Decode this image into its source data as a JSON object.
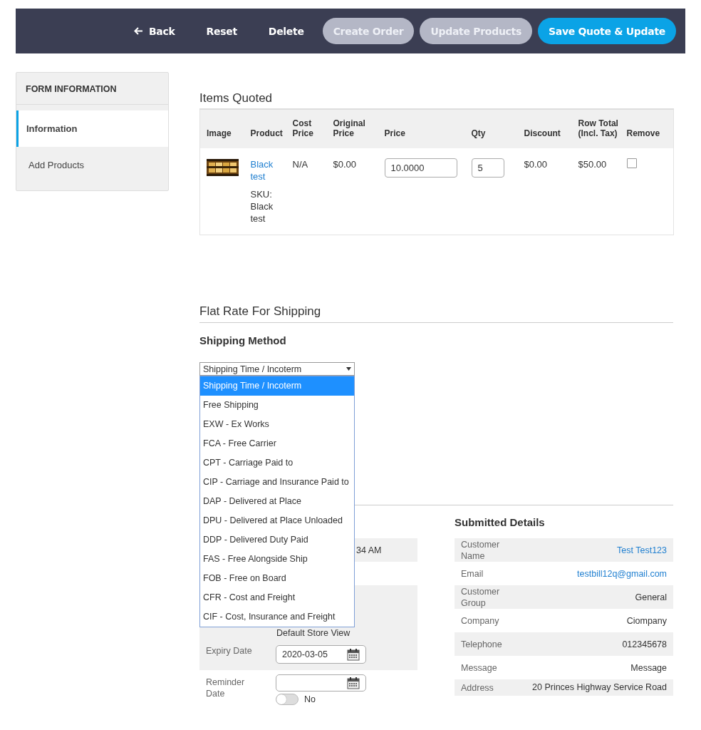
{
  "toolbar": {
    "buttons": [
      {
        "label": "Back",
        "kind": "back",
        "disabled": false
      },
      {
        "label": "Reset",
        "kind": "link",
        "disabled": false
      },
      {
        "label": "Delete",
        "kind": "link",
        "disabled": false
      },
      {
        "label": "Create Order",
        "kind": "pill",
        "disabled": true
      },
      {
        "label": "Update Products",
        "kind": "pill",
        "disabled": true
      },
      {
        "label": "Save Quote & Update",
        "kind": "primary",
        "disabled": false
      }
    ]
  },
  "sidebar": {
    "title": "FORM INFORMATION",
    "items": [
      {
        "label": "Information",
        "selected": true
      },
      {
        "label": "Add Products",
        "selected": false
      }
    ]
  },
  "items": {
    "title": "Items Quoted",
    "columns": [
      "Image",
      "Product",
      "Cost Price",
      "Original Price",
      "Price",
      "Qty",
      "Discount",
      "Row Total (Incl. Tax)",
      "Remove"
    ],
    "rows": [
      {
        "product": "Black test",
        "sku": "SKU: Black test",
        "cost_price": "N/A",
        "original_price": "$0.00",
        "price": "10.0000",
        "qty": "5",
        "discount": "$0.00",
        "row_total": "$50.00",
        "remove": false
      }
    ]
  },
  "shipping": {
    "title": "Flat Rate For Shipping",
    "subtitle": "Shipping Method",
    "select": {
      "value": "Shipping Time / Incoterm",
      "expanded": true,
      "options": [
        {
          "label": "Shipping Time / Incoterm",
          "selected": true
        },
        {
          "label": "Free Shipping",
          "selected": false
        },
        {
          "label": "EXW - Ex Works",
          "selected": false
        },
        {
          "label": "FCA - Free Carrier",
          "selected": false
        },
        {
          "label": "CPT - Carriage Paid to",
          "selected": false
        },
        {
          "label": "CIP - Carriage and Insurance Paid to",
          "selected": false
        },
        {
          "label": "DAP - Delivered at Place",
          "selected": false
        },
        {
          "label": "DPU - Delivered at Place Unloaded",
          "selected": false
        },
        {
          "label": "DDP - Delivered Duty Paid",
          "selected": false
        },
        {
          "label": "FAS - Free Alongside Ship",
          "selected": false
        },
        {
          "label": "FOB - Free on Board",
          "selected": false
        },
        {
          "label": "CFR - Cost and Freight",
          "selected": false
        },
        {
          "label": "CIF - Cost, Insurance and Freight",
          "selected": false
        }
      ]
    }
  },
  "quote_info": {
    "rows": [
      {
        "kind": "text",
        "value": "34 AM"
      },
      {
        "kind": "text",
        "value": "Default Store View"
      },
      {
        "kind": "date",
        "label": "Expiry Date",
        "value": "2020-03-05"
      },
      {
        "kind": "date",
        "label": "Reminder Date",
        "toggle": {
          "on": false,
          "label": "No"
        }
      }
    ]
  },
  "submitted_details": {
    "title": "Submitted Details",
    "rows": [
      {
        "label": "Customer Name",
        "value": "Test Test123",
        "kind": "link"
      },
      {
        "label": "Email",
        "value": "testbill12q@gmail.com",
        "kind": "link"
      },
      {
        "label": "Customer Group",
        "value": "General",
        "kind": "text"
      },
      {
        "label": "Company",
        "value": "Ciompany",
        "kind": "text"
      },
      {
        "label": "Telephone",
        "value": "012345678",
        "kind": "text"
      },
      {
        "label": "Message",
        "value": "Message",
        "kind": "text"
      },
      {
        "label": "Address",
        "value": "20 Princes Highway Service Road",
        "kind": "text"
      }
    ]
  }
}
